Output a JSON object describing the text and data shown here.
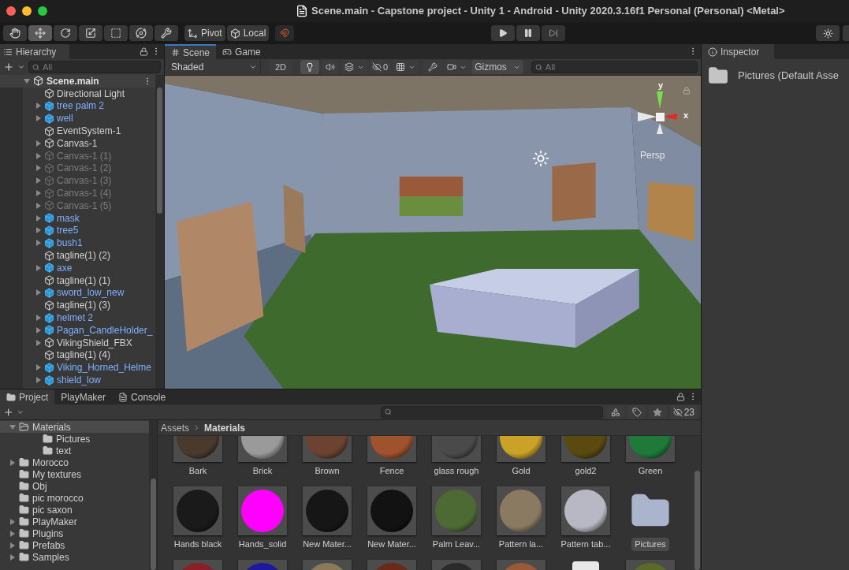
{
  "window": {
    "title": "Scene.main - Capstone project - Unity 1 - Android - Unity 2020.3.16f1 Personal (Personal) <Metal>"
  },
  "toolbar": {
    "tools": [
      {
        "kind": "hand",
        "selected": false
      },
      {
        "kind": "move",
        "selected": true
      },
      {
        "kind": "rotate",
        "selected": false
      },
      {
        "kind": "scale",
        "selected": false
      },
      {
        "kind": "rect",
        "selected": false
      },
      {
        "kind": "transform",
        "selected": false
      },
      {
        "kind": "custom",
        "selected": false
      }
    ],
    "pivot": "Pivot",
    "local": "Local"
  },
  "hierarchy": {
    "title": "Hierarchy",
    "search_placeholder": "All",
    "root": {
      "name": "Scene.main",
      "has_children": true,
      "expanded": true,
      "children": [
        {
          "name": "Directional Light",
          "kind": "object",
          "has_children": false,
          "disabled": false
        },
        {
          "name": "tree palm 2",
          "kind": "prefab",
          "has_children": true,
          "disabled": false
        },
        {
          "name": "well",
          "kind": "prefab",
          "has_children": true,
          "disabled": false
        },
        {
          "name": "EventSystem-1",
          "kind": "object",
          "has_children": false,
          "disabled": false
        },
        {
          "name": "Canvas-1",
          "kind": "object",
          "has_children": true,
          "disabled": false
        },
        {
          "name": "Canvas-1 (1)",
          "kind": "object",
          "has_children": true,
          "disabled": true
        },
        {
          "name": "Canvas-1 (2)",
          "kind": "object",
          "has_children": true,
          "disabled": true
        },
        {
          "name": "Canvas-1 (3)",
          "kind": "object",
          "has_children": true,
          "disabled": true
        },
        {
          "name": "Canvas-1 (4)",
          "kind": "object",
          "has_children": true,
          "disabled": true
        },
        {
          "name": "Canvas-1 (5)",
          "kind": "object",
          "has_children": true,
          "disabled": true
        },
        {
          "name": "mask",
          "kind": "prefab",
          "has_children": true,
          "disabled": false
        },
        {
          "name": "tree5",
          "kind": "prefab",
          "has_children": true,
          "disabled": false
        },
        {
          "name": "bush1",
          "kind": "prefab",
          "has_children": true,
          "disabled": false
        },
        {
          "name": "tagline(1) (2)",
          "kind": "object",
          "has_children": false,
          "disabled": false
        },
        {
          "name": "axe",
          "kind": "prefab",
          "has_children": true,
          "disabled": false
        },
        {
          "name": "tagline(1) (1)",
          "kind": "object",
          "has_children": false,
          "disabled": false
        },
        {
          "name": "sword_low_new",
          "kind": "prefab",
          "has_children": true,
          "disabled": false
        },
        {
          "name": "tagline(1) (3)",
          "kind": "object",
          "has_children": false,
          "disabled": false
        },
        {
          "name": "helmet 2",
          "kind": "prefab",
          "has_children": true,
          "disabled": false
        },
        {
          "name": "Pagan_CandleHolder_",
          "kind": "prefab",
          "has_children": true,
          "disabled": false
        },
        {
          "name": "VikingShield_FBX",
          "kind": "object",
          "has_children": true,
          "disabled": false
        },
        {
          "name": "tagline(1) (4)",
          "kind": "object",
          "has_children": false,
          "disabled": false
        },
        {
          "name": "Viking_Horned_Helme",
          "kind": "prefab",
          "has_children": true,
          "disabled": false
        },
        {
          "name": "shield_low",
          "kind": "prefab",
          "has_children": true,
          "disabled": false
        }
      ]
    }
  },
  "scene_view": {
    "tabs": [
      {
        "label": "Scene",
        "kind": "scene",
        "selected": true
      },
      {
        "label": "Game",
        "kind": "game",
        "selected": false
      }
    ],
    "shading": "Shaded",
    "mode_2d": "2D",
    "lighting_on": true,
    "hidden_count": "0",
    "gizmos": "Gizmos",
    "search_placeholder": "All",
    "axis_y": "y",
    "axis_x": "x",
    "projection": "Persp"
  },
  "inspector": {
    "title": "Inspector",
    "asset": "Pictures (Default Asse"
  },
  "project": {
    "tabs": [
      {
        "label": "Project",
        "kind": "project",
        "selected": true
      },
      {
        "label": "PlayMaker",
        "kind": "none",
        "selected": false
      },
      {
        "label": "Console",
        "kind": "console",
        "selected": false
      }
    ],
    "hidden_count": "23",
    "tree": [
      {
        "name": "Materials",
        "has_children": true,
        "expanded": true,
        "selected": true,
        "children": [
          {
            "name": "Pictures",
            "has_children": false,
            "selected": false
          },
          {
            "name": "text",
            "has_children": false,
            "selected": false
          }
        ]
      },
      {
        "name": "Morocco",
        "has_children": true,
        "selected": false
      },
      {
        "name": "My textures",
        "has_children": false,
        "selected": false
      },
      {
        "name": "Obj",
        "has_children": false,
        "selected": false
      },
      {
        "name": "pic morocco",
        "has_children": false,
        "selected": false
      },
      {
        "name": "pic saxon",
        "has_children": false,
        "selected": false
      },
      {
        "name": "PlayMaker",
        "has_children": true,
        "selected": false
      },
      {
        "name": "Plugins",
        "has_children": true,
        "selected": false
      },
      {
        "name": "Prefabs",
        "has_children": true,
        "selected": false
      },
      {
        "name": "Samples",
        "has_children": true,
        "selected": false
      }
    ],
    "breadcrumb": [
      "Assets",
      "Materials"
    ],
    "assets": [
      {
        "name": "Bark",
        "kind": "material",
        "color": "#4a3a2e"
      },
      {
        "name": "Brick",
        "kind": "material",
        "color": "#9a9a9a"
      },
      {
        "name": "Brown",
        "kind": "material",
        "color": "#6b4330"
      },
      {
        "name": "Fence",
        "kind": "material",
        "color": "#a0522d"
      },
      {
        "name": "glass rough",
        "kind": "material",
        "color": "#4a4a4a"
      },
      {
        "name": "Gold",
        "kind": "material",
        "color": "#c9a227"
      },
      {
        "name": "gold2",
        "kind": "material",
        "color": "#5a4a10"
      },
      {
        "name": "Green",
        "kind": "material",
        "color": "#1f7a3a"
      },
      {
        "name": "Hands black",
        "kind": "material",
        "color": "#1a1a1a"
      },
      {
        "name": "Hands_solid",
        "kind": "flat",
        "color": "#ff00ff"
      },
      {
        "name": "New Mater...",
        "kind": "material",
        "color": "#161616"
      },
      {
        "name": "New Mater...",
        "kind": "material",
        "color": "#121212"
      },
      {
        "name": "Palm Leav...",
        "kind": "material",
        "color": "#4d6a35"
      },
      {
        "name": "Pattern la...",
        "kind": "material",
        "color": "#8a7a62"
      },
      {
        "name": "Pattern tab...",
        "kind": "material",
        "color": "#b8b8c4"
      },
      {
        "name": "Pictures",
        "kind": "folder",
        "color": "#aab4cc"
      },
      {
        "kind": "material",
        "color": "#8a1f2a"
      },
      {
        "kind": "material",
        "color": "#1a1a9a"
      },
      {
        "kind": "material",
        "color": "#8a7a5a"
      },
      {
        "kind": "material",
        "color": "#6a2a1a"
      },
      {
        "kind": "material",
        "color": "#2a2a2a"
      },
      {
        "kind": "material",
        "color": "#9a5a3a"
      },
      {
        "kind": "file",
        "color": "#e8e8e8"
      },
      {
        "kind": "material",
        "color": "#5a6a2a"
      }
    ]
  }
}
